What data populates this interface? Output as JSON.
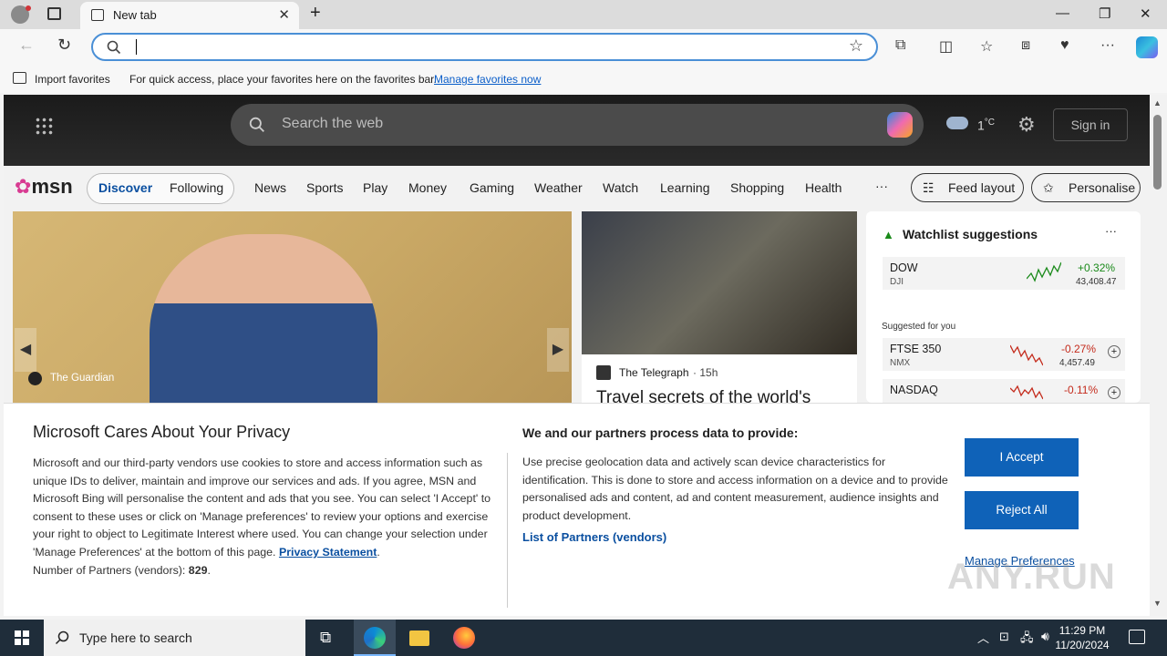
{
  "browser": {
    "tab_title": "New tab",
    "address_value": "",
    "favorites_bar": {
      "import_label": "Import favorites",
      "hint": "For quick access, place your favorites here on the favorites bar.",
      "manage_link": "Manage favorites now"
    }
  },
  "msn": {
    "search_placeholder": "Search the web",
    "weather_temp": "1",
    "weather_unit": "°C",
    "sign_in": "Sign in",
    "logo_text": "msn",
    "nav": {
      "discover": "Discover",
      "following": "Following",
      "items": [
        "News",
        "Sports",
        "Play",
        "Money",
        "Gaming",
        "Weather",
        "Watch",
        "Learning",
        "Shopping",
        "Health"
      ],
      "more": "···",
      "feed_layout": "Feed layout",
      "personalise": "Personalise"
    },
    "card1": {
      "source": "The Guardian"
    },
    "card2": {
      "source": "The Telegraph",
      "age": "15h",
      "headline": "Travel secrets of the world's"
    },
    "watchlist": {
      "title": "Watchlist suggestions",
      "more": "···",
      "suggested": "Suggested for you",
      "stocks": [
        {
          "name": "DOW",
          "ticker": "DJI",
          "change": "+0.32%",
          "price": "43,408.47",
          "color": "#1a8a1a"
        },
        {
          "name": "FTSE 350",
          "ticker": "NMX",
          "change": "-0.27%",
          "price": "4,457.49",
          "color": "#c42b1c"
        },
        {
          "name": "NASDAQ",
          "ticker": "",
          "change": "-0.11%",
          "price": "",
          "color": "#c42b1c"
        }
      ]
    }
  },
  "privacy": {
    "title": "Microsoft Cares About Your Privacy",
    "body": "Microsoft and our third-party vendors use cookies to store and access information such as unique IDs to deliver, maintain and improve our services and ads. If you agree, MSN and Microsoft Bing will personalise the content and ads that you see. You can select 'I Accept' to consent to these uses or click on 'Manage preferences' to review your options and exercise your right to object to Legitimate Interest where used.  You can change your selection under 'Manage Preferences' at the bottom of this page.",
    "privacy_link": "Privacy Statement",
    "partners_count_label": "Number of Partners (vendors):",
    "partners_count": "829",
    "right_heading": "We and our partners process data to provide:",
    "right_body": "Use precise geolocation data and actively scan device characteristics for identification. This is done to store and access information on a device and to provide personalised ads and content, ad and content measurement, audience insights and product development.",
    "partners_link": "List of Partners (vendors)",
    "accept": "I Accept",
    "reject": "Reject All",
    "manage": "Manage Preferences"
  },
  "taskbar": {
    "search_placeholder": "Type here to search",
    "time": "11:29 PM",
    "date": "11/20/2024"
  },
  "watermark": "ANY.RUN",
  "colors": {
    "accent": "#0f62b8",
    "link": "#0a4fa0",
    "taskbar": "#1f2d3a"
  }
}
